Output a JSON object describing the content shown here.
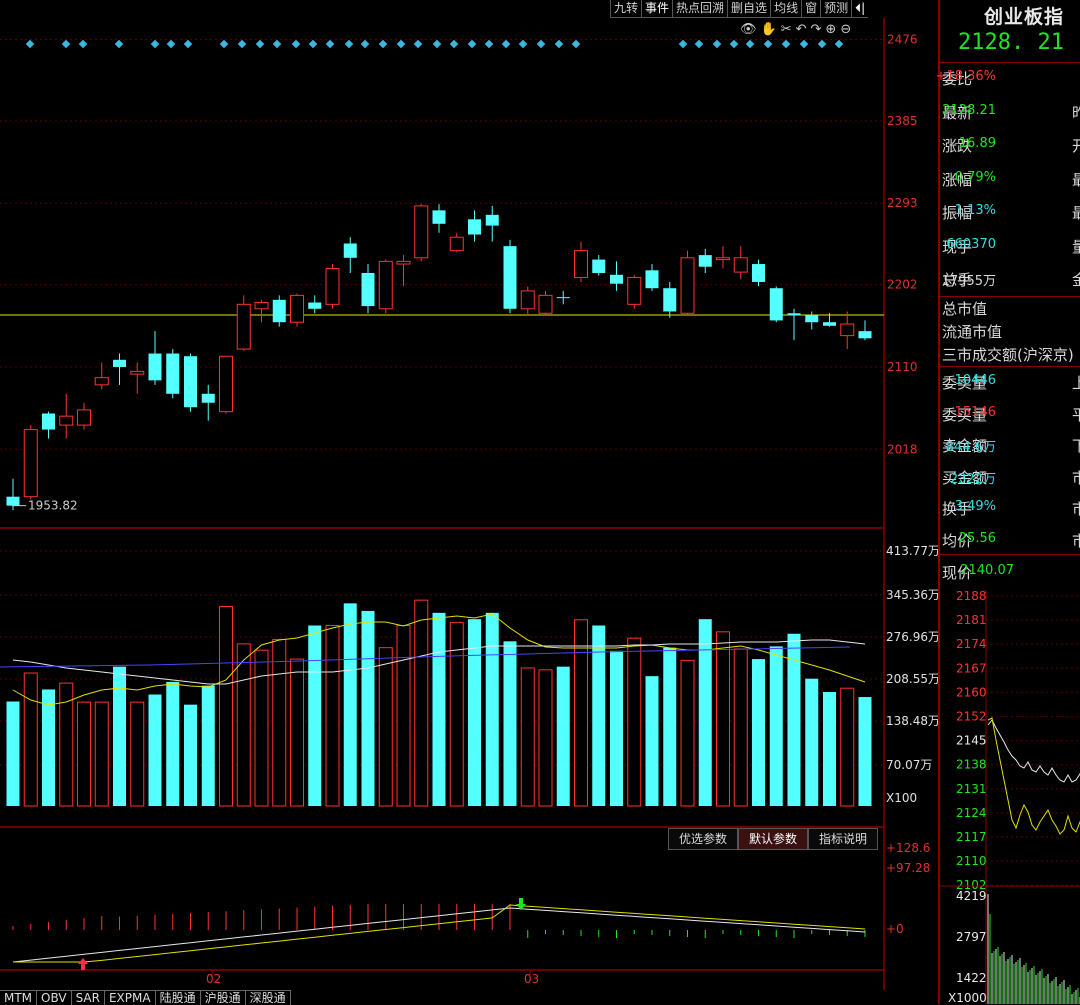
{
  "toolbar": {
    "items": [
      "九转",
      "事件",
      "热点回溯",
      "删自选",
      "均线",
      "窗",
      "预测"
    ],
    "exit_icon": "exit-icon"
  },
  "chart_icons": [
    "eye-icon",
    "hand-icon",
    "scissors-icon",
    "undo-icon",
    "redo-icon",
    "zoom-in-icon",
    "zoom-out-icon"
  ],
  "price_axis": {
    "labels": [
      "2476",
      "2385",
      "2293",
      "2202",
      "2110",
      "2018"
    ],
    "low_label": "1953.82"
  },
  "volume_axis": {
    "labels": [
      "413.77万",
      "345.36万",
      "276.96万",
      "208.55万",
      "138.48万",
      "70.07万"
    ],
    "unit": "X100"
  },
  "indicator_axis": {
    "labels": [
      "+128.6",
      "+97.28",
      "+0"
    ]
  },
  "date_labels": [
    "02",
    "03"
  ],
  "param_tabs": [
    "优选参数",
    "默认参数",
    "指标说明"
  ],
  "param_tab_active": "默认参数",
  "bottom_tabs": [
    "MTM",
    "OBV",
    "SAR",
    "EXPMA",
    "陆股通",
    "沪股通",
    "深股通"
  ],
  "chart_data": {
    "type": "candlestick",
    "ylim": [
      1930,
      2500
    ],
    "reference_line": 2168,
    "candles": [
      {
        "o": 1965,
        "h": 1985,
        "l": 1950,
        "c": 1955,
        "up": false
      },
      {
        "o": 1965,
        "h": 2045,
        "l": 1962,
        "c": 2040,
        "up": true
      },
      {
        "o": 2040,
        "h": 2060,
        "l": 2030,
        "c": 2058,
        "up": false
      },
      {
        "o": 2045,
        "h": 2080,
        "l": 2030,
        "c": 2055,
        "up": true
      },
      {
        "o": 2045,
        "h": 2070,
        "l": 2040,
        "c": 2062,
        "up": true
      },
      {
        "o": 2090,
        "h": 2115,
        "l": 2085,
        "c": 2098,
        "up": true
      },
      {
        "o": 2118,
        "h": 2125,
        "l": 2090,
        "c": 2110,
        "up": false
      },
      {
        "o": 2105,
        "h": 2115,
        "l": 2080,
        "c": 2102,
        "up": true
      },
      {
        "o": 2125,
        "h": 2150,
        "l": 2090,
        "c": 2095,
        "up": false
      },
      {
        "o": 2125,
        "h": 2130,
        "l": 2075,
        "c": 2080,
        "up": false
      },
      {
        "o": 2122,
        "h": 2125,
        "l": 2060,
        "c": 2065,
        "up": false
      },
      {
        "o": 2080,
        "h": 2090,
        "l": 2050,
        "c": 2070,
        "up": false
      },
      {
        "o": 2060,
        "h": 2122,
        "l": 2058,
        "c": 2122,
        "up": true
      },
      {
        "o": 2130,
        "h": 2190,
        "l": 2128,
        "c": 2180,
        "up": true
      },
      {
        "o": 2175,
        "h": 2185,
        "l": 2160,
        "c": 2182,
        "up": true
      },
      {
        "o": 2185,
        "h": 2190,
        "l": 2155,
        "c": 2160,
        "up": false
      },
      {
        "o": 2160,
        "h": 2192,
        "l": 2155,
        "c": 2190,
        "up": true
      },
      {
        "o": 2182,
        "h": 2190,
        "l": 2170,
        "c": 2175,
        "up": false
      },
      {
        "o": 2180,
        "h": 2225,
        "l": 2175,
        "c": 2220,
        "up": true
      },
      {
        "o": 2248,
        "h": 2255,
        "l": 2215,
        "c": 2232,
        "up": false
      },
      {
        "o": 2215,
        "h": 2225,
        "l": 2170,
        "c": 2178,
        "up": false
      },
      {
        "o": 2175,
        "h": 2230,
        "l": 2170,
        "c": 2228,
        "up": true
      },
      {
        "o": 2225,
        "h": 2235,
        "l": 2200,
        "c": 2228,
        "up": true
      },
      {
        "o": 2232,
        "h": 2292,
        "l": 2228,
        "c": 2290,
        "up": true
      },
      {
        "o": 2285,
        "h": 2292,
        "l": 2260,
        "c": 2270,
        "up": false
      },
      {
        "o": 2240,
        "h": 2260,
        "l": 2238,
        "c": 2255,
        "up": true
      },
      {
        "o": 2275,
        "h": 2285,
        "l": 2250,
        "c": 2258,
        "up": false
      },
      {
        "o": 2268,
        "h": 2290,
        "l": 2250,
        "c": 2280,
        "up": false
      },
      {
        "o": 2245,
        "h": 2252,
        "l": 2170,
        "c": 2175,
        "up": false
      },
      {
        "o": 2175,
        "h": 2200,
        "l": 2168,
        "c": 2195,
        "up": true
      },
      {
        "o": 2170,
        "h": 2195,
        "l": 2168,
        "c": 2190,
        "up": true
      },
      {
        "o": 2188,
        "h": 2195,
        "l": 2180,
        "c": 2188,
        "up": false
      },
      {
        "o": 2210,
        "h": 2250,
        "l": 2205,
        "c": 2240,
        "up": true
      },
      {
        "o": 2230,
        "h": 2235,
        "l": 2212,
        "c": 2215,
        "up": false
      },
      {
        "o": 2213,
        "h": 2228,
        "l": 2195,
        "c": 2203,
        "up": false
      },
      {
        "o": 2180,
        "h": 2213,
        "l": 2175,
        "c": 2210,
        "up": true
      },
      {
        "o": 2218,
        "h": 2225,
        "l": 2195,
        "c": 2198,
        "up": false
      },
      {
        "o": 2198,
        "h": 2205,
        "l": 2165,
        "c": 2172,
        "up": false
      },
      {
        "o": 2170,
        "h": 2240,
        "l": 2168,
        "c": 2232,
        "up": true
      },
      {
        "o": 2235,
        "h": 2242,
        "l": 2215,
        "c": 2222,
        "up": false
      },
      {
        "o": 2230,
        "h": 2245,
        "l": 2220,
        "c": 2232,
        "up": true
      },
      {
        "o": 2232,
        "h": 2245,
        "l": 2208,
        "c": 2216,
        "up": true
      },
      {
        "o": 2225,
        "h": 2230,
        "l": 2200,
        "c": 2205,
        "up": false
      },
      {
        "o": 2198,
        "h": 2200,
        "l": 2160,
        "c": 2162,
        "up": false
      },
      {
        "o": 2170,
        "h": 2175,
        "l": 2140,
        "c": 2168,
        "up": false
      },
      {
        "o": 2168,
        "h": 2172,
        "l": 2152,
        "c": 2160,
        "up": false
      },
      {
        "o": 2160,
        "h": 2170,
        "l": 2155,
        "c": 2156,
        "up": false
      },
      {
        "o": 2145,
        "h": 2172,
        "l": 2130,
        "c": 2158,
        "up": true
      },
      {
        "o": 2150,
        "h": 2162,
        "l": 2140,
        "c": 2142,
        "up": false
      }
    ],
    "volume": {
      "ylim": [
        0,
        4200000
      ],
      "values": [
        1650000,
        2100000,
        1840000,
        1940000,
        1640000,
        1640000,
        2200000,
        1640000,
        1760000,
        1960000,
        1600000,
        1900000,
        3150000,
        2560000,
        2460000,
        2630000,
        2320000,
        2850000,
        2850000,
        3200000,
        3080000,
        2500000,
        2850000,
        3250000,
        3050000,
        2900000,
        2950000,
        3050000,
        2600000,
        2180000,
        2150000,
        2200000,
        2940000,
        2850000,
        2450000,
        2650000,
        2050000,
        2500000,
        2300000,
        2950000,
        2750000,
        2480000,
        2320000,
        2520000,
        2720000,
        2010000,
        1800000,
        1860000,
        1720000
      ],
      "up": [
        false,
        true,
        false,
        true,
        true,
        true,
        false,
        true,
        false,
        false,
        false,
        false,
        true,
        true,
        true,
        true,
        true,
        false,
        true,
        false,
        false,
        true,
        true,
        true,
        false,
        true,
        false,
        false,
        false,
        true,
        true,
        false,
        true,
        false,
        false,
        true,
        false,
        false,
        true,
        false,
        true,
        true,
        false,
        false,
        false,
        false,
        false,
        true,
        false
      ]
    },
    "minute_panel": {
      "ylim": [
        2102,
        2188
      ],
      "labels": [
        "2188",
        "2181",
        "2174",
        "2167",
        "2160",
        "2152",
        "2145",
        "2138",
        "2131",
        "2124",
        "2117",
        "2110",
        "2102"
      ],
      "vol_labels": [
        "4219",
        "2797",
        "1422"
      ],
      "vol_unit": "X1000"
    }
  },
  "quote": {
    "name": "创业板指",
    "price": "2128. 21",
    "rows": [
      {
        "label": "委比",
        "value": "+18.36%",
        "color": "r",
        "tail": ""
      },
      {
        "label": "最新",
        "value": "2128.21",
        "color": "g",
        "tail": "昨"
      },
      {
        "label": "涨跌",
        "value": "-16.89",
        "color": "g",
        "tail": "开"
      },
      {
        "label": "涨幅",
        "value": "-0.79%",
        "color": "g",
        "tail": "最"
      },
      {
        "label": "振幅",
        "value": "1.13%",
        "color": "c",
        "tail": "最"
      },
      {
        "label": "现手",
        "value": "660370",
        "color": "c",
        "tail": "量"
      },
      {
        "label": "总手",
        "value": "17955万",
        "color": "w",
        "tail": "金"
      }
    ],
    "mid_labels": [
      "总市值",
      "流通市值",
      "三市成交额(沪深京)"
    ],
    "rows2": [
      {
        "label": "委卖量",
        "value": "10446",
        "color": "c",
        "tail": "上"
      },
      {
        "label": "委买量",
        "value": "15146",
        "color": "r",
        "tail": "平"
      },
      {
        "label": "卖金额",
        "value": "844.6万",
        "color": "c",
        "tail": "下"
      },
      {
        "label": "买金额",
        "value": "2322万",
        "color": "c",
        "tail": "市"
      },
      {
        "label": "换手",
        "value": "3.49%",
        "color": "c",
        "tail": "市"
      },
      {
        "label": "均价",
        "value": "25.56",
        "color": "g",
        "tail": "市"
      }
    ],
    "current_price_label": "现价",
    "current_price_value": "2140.07"
  }
}
